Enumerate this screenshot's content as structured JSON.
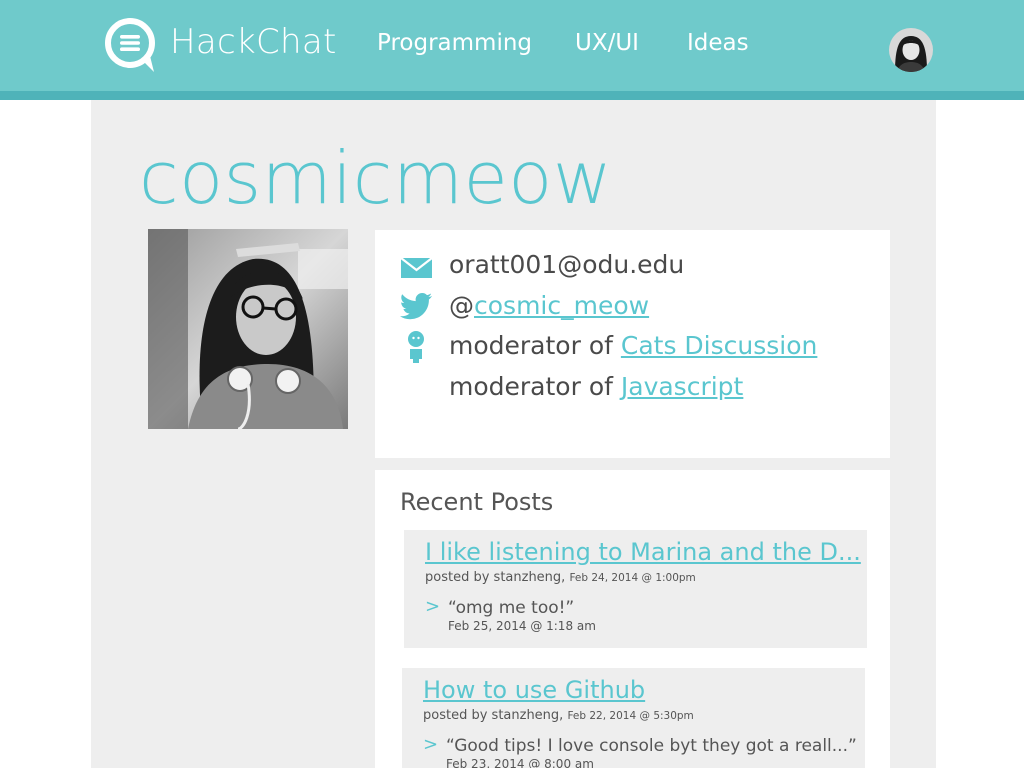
{
  "brand": {
    "name": "HackChat"
  },
  "nav": {
    "items": [
      {
        "label": "Programming"
      },
      {
        "label": "UX/UI"
      },
      {
        "label": "Ideas"
      }
    ]
  },
  "profile": {
    "username": "cosmicmeow",
    "email": "oratt001@odu.edu",
    "twitter_prefix": "@",
    "twitter_handle": "cosmic_meow",
    "moderator_prefix": "moderator of",
    "moderated": [
      {
        "name": "Cats Discussion"
      },
      {
        "name": "Javascript"
      }
    ]
  },
  "recent_posts": {
    "title": "Recent Posts",
    "posts": [
      {
        "title": "I like listening to Marina and the D...",
        "posted_by_prefix": "posted by",
        "author": "stanzheng,",
        "date": "Feb 24, 2014 @ 1:00pm",
        "reply_marker": ">",
        "reply": "“omg me too!”",
        "reply_date": "Feb 25, 2014 @ 1:18 am"
      },
      {
        "title": "How to use Github",
        "posted_by_prefix": "posted by",
        "author": "stanzheng,",
        "date": "Feb 22, 2014 @ 5:30pm",
        "reply_marker": ">",
        "reply": "“Good tips! I love console byt they got a reall...”",
        "reply_date": "Feb 23, 2014 @ 8:00 am"
      }
    ]
  },
  "colors": {
    "topbar": "#6fcacb",
    "topbar_shadow": "#4fb3b9",
    "accent": "#5ac6cf",
    "panel": "#eeeeee",
    "text": "#4a4a4a"
  },
  "icons": {
    "logo": "chat-bubble-logo-icon",
    "email": "envelope-icon",
    "twitter": "twitter-bird-icon",
    "moderator": "person-icon"
  }
}
